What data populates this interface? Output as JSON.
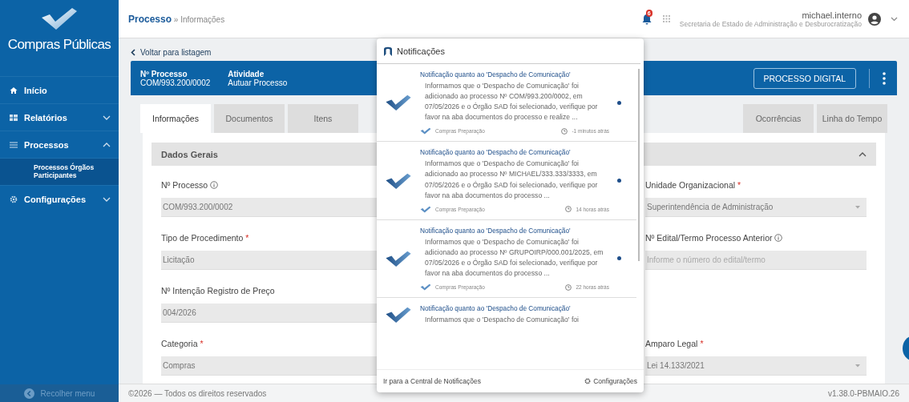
{
  "sidebar": {
    "brand": "Compras Públicas",
    "items": [
      {
        "label": "Início",
        "selected": false
      },
      {
        "label": "Relatórios",
        "selected": false,
        "expanded": false
      },
      {
        "label": "Processos",
        "selected": false,
        "expanded": true,
        "children": [
          {
            "label": "Processos Órgãos Participantes",
            "selected": true
          }
        ]
      },
      {
        "label": "Configurações",
        "selected": false,
        "expanded": false
      }
    ],
    "collapse": "Recolher menu"
  },
  "topbar": {
    "breadcrumb": {
      "root": "Processo",
      "separator": "»",
      "current": "Informações"
    },
    "badge": "6",
    "user": "michael.interno",
    "org": "Secretaria de Estado de Administração e Desburocratização"
  },
  "back_link": "Voltar para listagem",
  "header": {
    "fields": [
      {
        "label": "Nº Processo",
        "value": "COM/993.200/0002"
      },
      {
        "label": "Atividade",
        "value": "Autuar Processo"
      }
    ],
    "button": "PROCESSO DIGITAL"
  },
  "tabs": [
    {
      "label": "Informações",
      "selected": true
    },
    {
      "label": "Documentos",
      "selected": false
    },
    {
      "label": "Itens",
      "selected": false
    },
    {
      "label": "Ocorrências",
      "selected": false
    },
    {
      "label": "Linha do Tempo",
      "selected": false
    }
  ],
  "section": {
    "title": "Dados Gerais",
    "expanded": true,
    "rows": [
      {
        "left": {
          "label": "Nº Processo",
          "info": true,
          "value": "COM/993.200/0002",
          "kind": "text"
        },
        "right": {
          "label": "Unidade Organizacional",
          "info": false,
          "required_mark": "*",
          "value": "Superintendência de Administração",
          "kind": "select"
        }
      },
      {
        "left": {
          "label": "Tipo de Procedimento",
          "info": false,
          "required_mark": "*",
          "value": "Licitação",
          "kind": "text"
        },
        "right": {
          "label": "Nº Edital/Termo Processo Anterior",
          "info": true,
          "placeholder": "Informe o número do edital/termo",
          "kind": "text"
        }
      },
      {
        "left": {
          "label": "Nº Intenção Registro de Preço",
          "info": false,
          "value": "004/2026",
          "kind": "text"
        }
      },
      {
        "left": {
          "label": "Categoria",
          "info": false,
          "required_mark": "*",
          "value": "Compras",
          "kind": "text"
        },
        "right": {
          "label": "Amparo Legal",
          "info": false,
          "required_mark": "*",
          "value": "Lei 14.133/2021",
          "kind": "select"
        }
      }
    ]
  },
  "notifications": {
    "title": "Notificações",
    "items": [
      {
        "title": "Notificação quanto ao 'Despacho de Comunicação'",
        "body": "Informamos que o 'Despacho de Comunicação' foi adicionado ao processo Nº COM/993.200/0002, em 07/05/2026 e o Órgão SAD foi selecionado, verifique por favor na aba documentos do processo e realize ...",
        "source": "Compras Preparação",
        "time": "-1 minutos atrás",
        "unread": true
      },
      {
        "title": "Notificação quanto ao 'Despacho de Comunicação'",
        "body": "Informamos que o 'Despacho de Comunicação' foi adicionado ao processo Nº MICHAEL/333.333/3333, em 07/05/2026 e o Órgão SAD foi selecionado, verifique por favor na aba documentos do processo ...",
        "source": "Compras Preparação",
        "time": "14 horas atrás",
        "unread": true
      },
      {
        "title": "Notificação quanto ao 'Despacho de Comunicação'",
        "body": "Informamos que o 'Despacho de Comunicação' foi adicionado ao processo Nº GRUPOIRP/000.001/2025, em 07/05/2026 e o Órgão SAD foi selecionado, verifique por favor na aba documentos do processo ...",
        "source": "Compras Preparação",
        "time": "22 horas atrás",
        "unread": true
      },
      {
        "title": "Notificação quanto ao 'Despacho de Comunicação'",
        "body": "Informamos que o 'Despacho de Comunicação' foi",
        "unread": false
      }
    ],
    "link": "Ir para a Central de Notificações",
    "settings": "Configurações"
  },
  "footer": {
    "copyright": "©2026 — Todos os direitos reservados",
    "version": "v1.38.0-PBMAIO.26"
  }
}
